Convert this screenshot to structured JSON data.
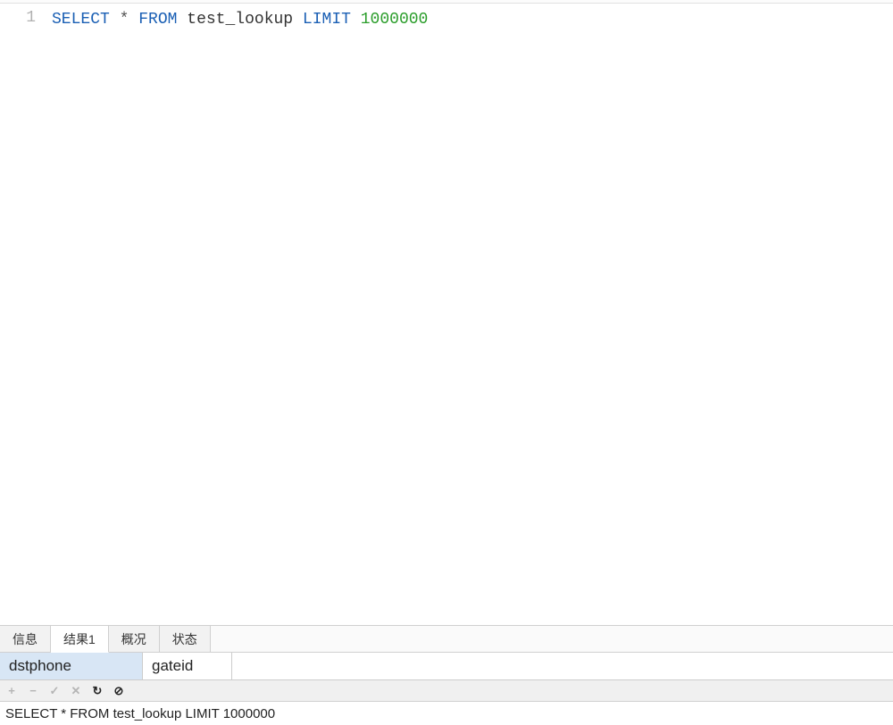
{
  "editor": {
    "line_number": "1",
    "tokens": {
      "select": "SELECT",
      "star": "*",
      "from": "FROM",
      "table": "test_lookup",
      "limit": "LIMIT",
      "number": "1000000"
    }
  },
  "tabs": [
    {
      "label": "信息",
      "active": false
    },
    {
      "label": "结果1",
      "active": true
    },
    {
      "label": "概况",
      "active": false
    },
    {
      "label": "状态",
      "active": false
    }
  ],
  "result_columns": [
    {
      "name": "dstphone",
      "selected": true
    },
    {
      "name": "gateid",
      "selected": false
    }
  ],
  "toolbar": {
    "plus": "+",
    "minus": "−",
    "check": "✓",
    "cross": "✕",
    "refresh": "↻",
    "stop": "⊘"
  },
  "status_bar": {
    "text": "SELECT * FROM test_lookup LIMIT 1000000"
  }
}
